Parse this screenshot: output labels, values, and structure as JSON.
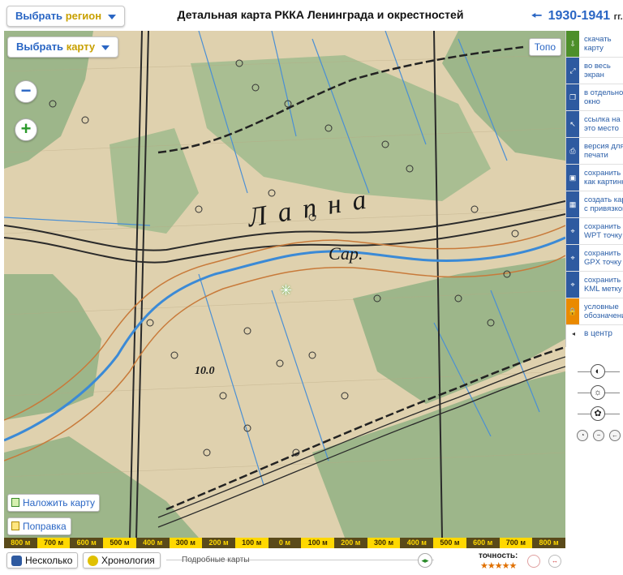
{
  "header": {
    "region_select": {
      "prefix": "Выбрать",
      "highlight": "регион"
    },
    "title": "Детальная карта РККА Ленинграда и окрестностей",
    "period": {
      "years": "1930-1941",
      "suffix": "гг."
    }
  },
  "map": {
    "map_select": {
      "prefix": "Выбрать",
      "highlight": "карту"
    },
    "topo_label": "Топо",
    "overlay_label": "Наложить карту",
    "correction_label": "Поправка",
    "labels": {
      "river": "Лапна",
      "place": "Сар.",
      "height": "10.0"
    }
  },
  "scalebar": {
    "segments": [
      "800 м",
      "700 м",
      "600 м",
      "500 м",
      "400 м",
      "300 м",
      "200 м",
      "100 м",
      "0 м",
      "100 м",
      "200 м",
      "300 м",
      "400 м",
      "500 м",
      "600 м",
      "700 м",
      "800 м"
    ]
  },
  "bottom": {
    "several_label": "Несколько",
    "chronology_label": "Хронология",
    "similar_maps_label": "Подробные карты",
    "accuracy_label": "точность:",
    "accuracy_stars": "★★★★★"
  },
  "right_panel": {
    "items": [
      {
        "icon": "download-icon",
        "label_line1": "скачать",
        "label_line2": "карту"
      },
      {
        "icon": "fullscreen-icon",
        "label_line1": "во весь",
        "label_line2": "экран"
      },
      {
        "icon": "new-window-icon",
        "label_line1": "в отдельно",
        "label_line2": "окно"
      },
      {
        "icon": "link-icon",
        "label_line1": "ссылка на",
        "label_line2": "это место"
      },
      {
        "icon": "print-icon",
        "label_line1": "версия для",
        "label_line2": "печати"
      },
      {
        "icon": "save-image-icon",
        "label_line1": "сохранить",
        "label_line2": "как картинк"
      },
      {
        "icon": "georef-icon",
        "label_line1": "создать карт",
        "label_line2": "с привязкой"
      },
      {
        "icon": "wpt-icon",
        "label_line1": "сохранить",
        "label_line2": "WPT точку"
      },
      {
        "icon": "gpx-icon",
        "label_line1": "сохранить",
        "label_line2": "GPX точку"
      },
      {
        "icon": "kml-icon",
        "label_line1": "сохранить",
        "label_line2": "KML метку"
      },
      {
        "icon": "legend-icon",
        "label_line1": "условные",
        "label_line2": "обозначени"
      }
    ],
    "center_link": "в центр"
  },
  "colors": {
    "accent": "#2a66c4",
    "highlight": "#c8a000",
    "scale_yellow": "#ffd800",
    "map_paper": "#e0d3b0",
    "map_green": "#9cb68a",
    "river": "#3b8ad6"
  }
}
